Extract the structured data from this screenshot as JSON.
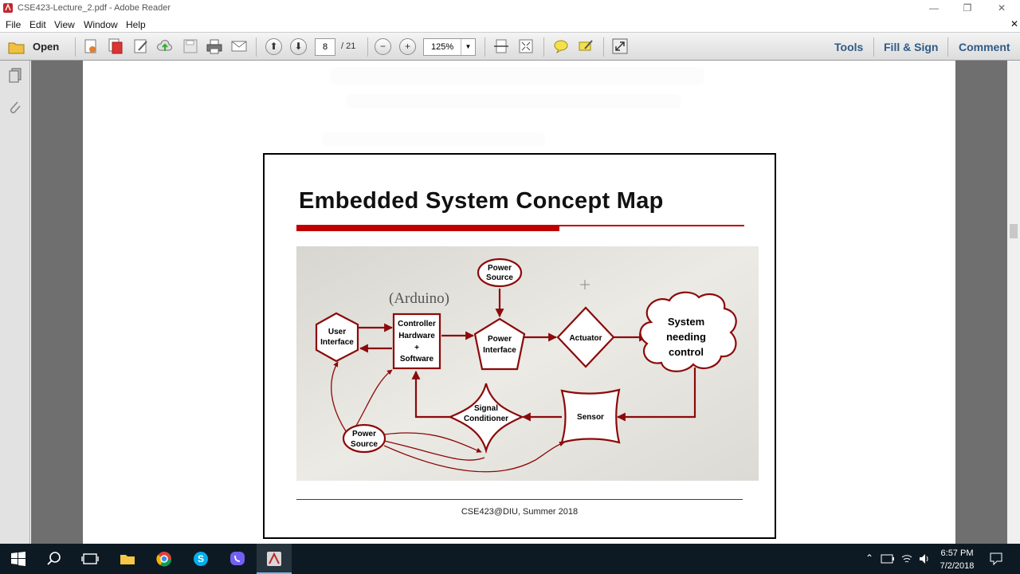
{
  "window": {
    "title": "CSE423-Lecture_2.pdf - Adobe Reader",
    "minimize": "—",
    "restore": "❐",
    "close": "✕"
  },
  "menu": [
    "File",
    "Edit",
    "View",
    "Window",
    "Help"
  ],
  "toolbar": {
    "open_label": "Open",
    "page_current": "8",
    "page_total": "/ 21",
    "zoom_value": "125%",
    "zoom_options": [
      "125%"
    ],
    "tools_label": "Tools",
    "fillsign_label": "Fill & Sign",
    "comment_label": "Comment"
  },
  "slide": {
    "title": "Embedded System Concept Map",
    "footer": "CSE423@DIU, Summer 2018",
    "diagram": {
      "arduino_label": "(Arduino)",
      "power_source_top": [
        "Power",
        "Source"
      ],
      "user_interface": [
        "User",
        "Interface"
      ],
      "controller": [
        "Controller",
        "Hardware",
        "+",
        "Software"
      ],
      "power_interface": [
        "Power",
        "Interface"
      ],
      "actuator": "Actuator",
      "system": [
        "System",
        "needing",
        "control"
      ],
      "signal_conditioner": [
        "Signal",
        "Conditioner"
      ],
      "sensor": "Sensor",
      "power_source_bottom": [
        "Power",
        "Source"
      ]
    }
  },
  "taskbar": {
    "time": "6:57 PM",
    "date": "7/2/2018"
  },
  "colors": {
    "accent_red": "#c00000",
    "diagram_red": "#8b0a0a",
    "link_blue": "#2f5b86",
    "taskbar": "#0e1a23"
  }
}
